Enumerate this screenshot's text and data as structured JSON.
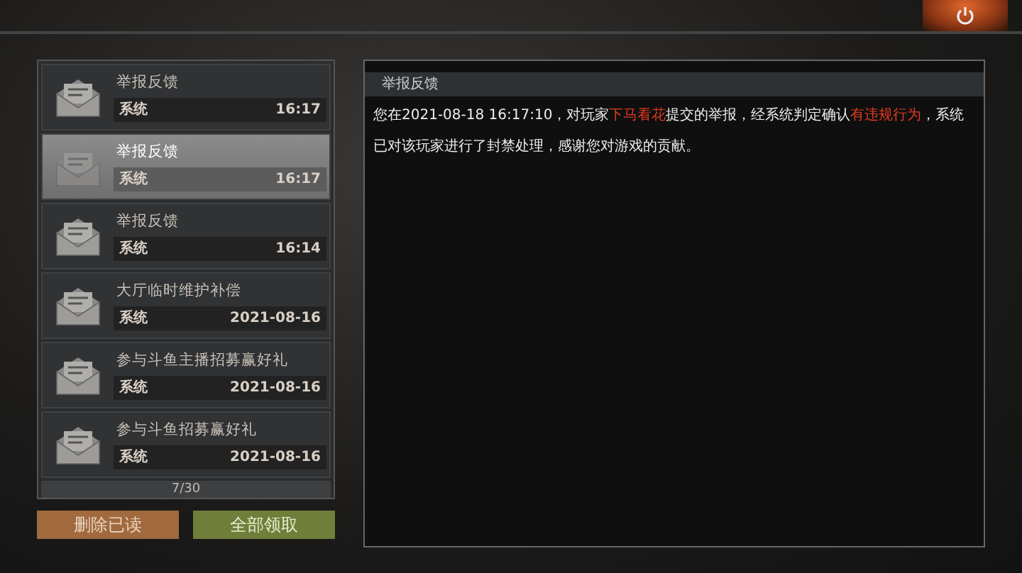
{
  "mails": [
    {
      "title": "举报反馈",
      "sender": "系统",
      "time": "16:17",
      "selected": false
    },
    {
      "title": "举报反馈",
      "sender": "系统",
      "time": "16:17",
      "selected": true
    },
    {
      "title": "举报反馈",
      "sender": "系统",
      "time": "16:14",
      "selected": false
    },
    {
      "title": "大厅临时维护补偿",
      "sender": "系统",
      "time": "2021-08-16",
      "selected": false
    },
    {
      "title": "参与斗鱼主播招募赢好礼",
      "sender": "系统",
      "time": "2021-08-16",
      "selected": false
    },
    {
      "title": "参与斗鱼招募赢好礼",
      "sender": "系统",
      "time": "2021-08-16",
      "selected": false
    }
  ],
  "pager": "7/30",
  "buttons": [
    {
      "label": "删除已读",
      "kind": "delete"
    },
    {
      "label": "全部领取",
      "kind": "claim"
    }
  ],
  "detail": {
    "title": "举报反馈",
    "body": [
      {
        "text": "您在2021-08-18 16:17:10，对玩家",
        "highlight": false
      },
      {
        "text": "下马看花",
        "highlight": true
      },
      {
        "text": "提交的举报，经系统判定确认",
        "highlight": false
      },
      {
        "text": "有违规行为",
        "highlight": true
      },
      {
        "text": "，系统已对该玩家进行了封禁处理，感谢您对游戏的贡献。",
        "highlight": false
      }
    ]
  }
}
